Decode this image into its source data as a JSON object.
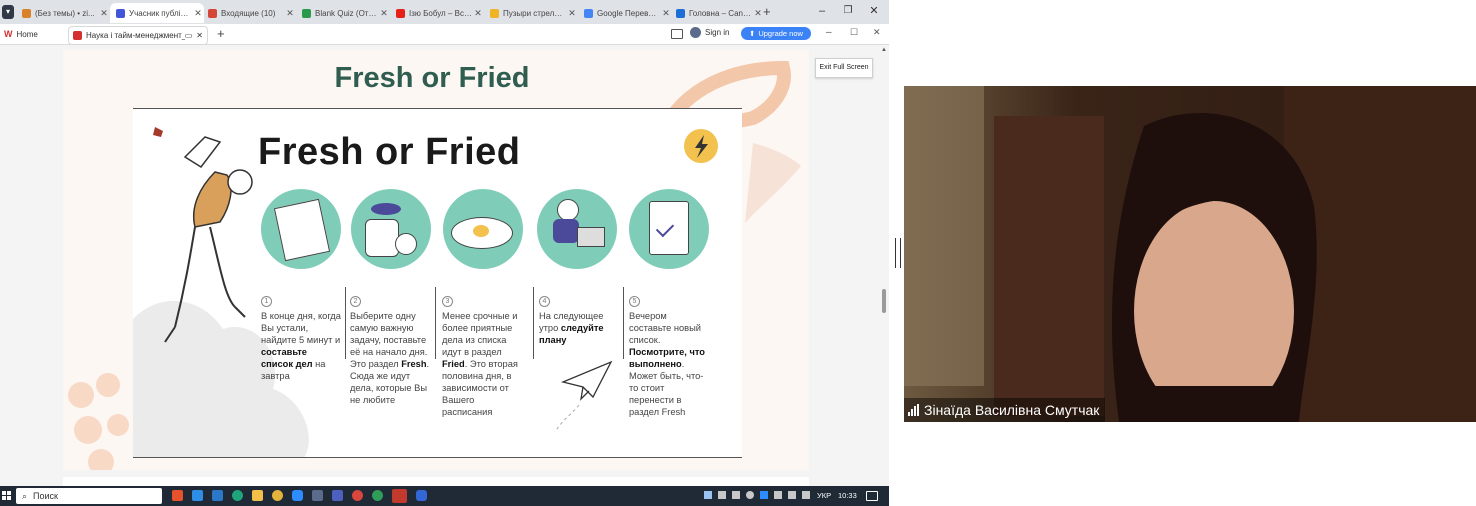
{
  "tabs": [
    {
      "title": "(Без темы) • zi...",
      "fav": "#d9822b",
      "fav_icon": "mail-icon"
    },
    {
      "title": "Учасник публікації",
      "fav": "#4356d8",
      "fav_icon": "zoom-icon"
    },
    {
      "title": "Входящие (10)",
      "fav": "#d44638",
      "fav_icon": "gmail-icon"
    },
    {
      "title": "Blank Quiz (Отв...",
      "fav": "#2a9a4a",
      "fav_icon": "sheets-icon"
    },
    {
      "title": "Ізю Бобул – Вси...",
      "fav": "#e62117",
      "fav_icon": "youtube-icon"
    },
    {
      "title": "Пузыри стреляли...",
      "fav": "#f0b323",
      "fav_icon": "game-icon"
    },
    {
      "title": "Google Перевод...",
      "fav": "#4285f4",
      "fav_icon": "translate-icon"
    },
    {
      "title": "Головна – Canv...",
      "fav": "#1d6fd8",
      "fav_icon": "canva-icon"
    }
  ],
  "new_tab": "+",
  "window": {
    "minimize": "–",
    "maximize": "❐",
    "close": "✕"
  },
  "bar": {
    "home": "Home",
    "doc_tab": "Наука і тайм-менеджмент_e...",
    "new_tab": "+",
    "sign_in": "Sign in",
    "upgrade": "Upgrade now",
    "minimize": "–",
    "maximize": "☐",
    "close": "✕"
  },
  "exit_full_screen": "Exit Full Screen",
  "slide": {
    "title": "Fresh or Fried",
    "inner_title": "Fresh or Fried",
    "steps": [
      {
        "num": "1",
        "pre": "В конце дня, когда Вы устали, найдите 5 минут и ",
        "bold": "составьте список дел",
        "post": " на завтра"
      },
      {
        "num": "2",
        "pre": "Выберите одну самую важную задачу, поставьте её на начало дня. Это раздел ",
        "bold": "Fresh",
        "post": ". Сюда же идут дела, которые Вы не любите"
      },
      {
        "num": "3",
        "pre": "Менее срочные и более приятные дела из списка идут в раздел ",
        "bold": "Fried",
        "post": ". Это вторая половина дня, в зависимости от Вашего расписания"
      },
      {
        "num": "4",
        "pre": "На следующее утро ",
        "bold": "следуйте плану",
        "post": ""
      },
      {
        "num": "5",
        "pre": "Вечером составьте новый список. ",
        "bold": "Посмотрите, что выполнено",
        "post": ". Может быть, что-то стоит перенести в раздел Fresh"
      }
    ]
  },
  "taskbar": {
    "search": "Поиск",
    "lang": "УКР",
    "time": "10:33"
  },
  "participant": {
    "name": "Зінаїда Василівна Смутчак"
  },
  "colors": {
    "accent": "#2f5d50",
    "teal": "#7fcdb8",
    "upgrade": "#3b82f6"
  }
}
